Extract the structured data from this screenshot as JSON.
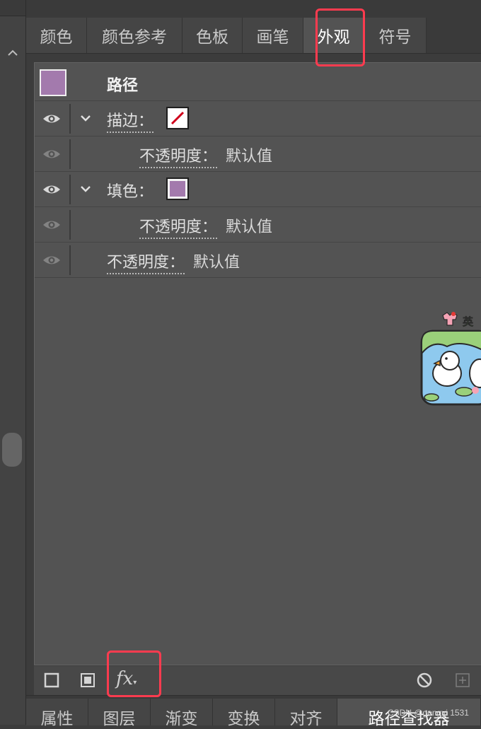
{
  "tabs": [
    {
      "label": "颜色"
    },
    {
      "label": "颜色参考"
    },
    {
      "label": "色板"
    },
    {
      "label": "画笔"
    },
    {
      "label": "外观",
      "active": true
    },
    {
      "label": "符号"
    }
  ],
  "appearance": {
    "object_label": "路径",
    "object_color": "#a37aad",
    "stroke": {
      "label": "描边：",
      "color": "none",
      "opacity_label": "不透明度：",
      "opacity_value": "默认值"
    },
    "fill": {
      "label": "填色：",
      "color": "#a37aad",
      "opacity_label": "不透明度：",
      "opacity_value": "默认值"
    },
    "opacity": {
      "label": "不透明度：",
      "value": "默认值"
    }
  },
  "toolbar": {
    "add_stroke_icon": "square-outline-icon",
    "add_fill_icon": "square-filled-icon",
    "fx_label": "fx",
    "clear_icon": "no-icon",
    "duplicate_icon": "plus-icon"
  },
  "bottom_tabs": [
    {
      "label": "属性"
    },
    {
      "label": "图层"
    },
    {
      "label": "渐变"
    },
    {
      "label": "变换"
    },
    {
      "label": "对齐"
    },
    {
      "label": "路径查找器",
      "active": true
    }
  ],
  "sticker_text": "英",
  "watermark": "CSDN @gongyi 1531",
  "colors": {
    "highlight": "#ff3b4f",
    "panel_bg": "#535353",
    "stroke_slash": "#d0021b"
  }
}
